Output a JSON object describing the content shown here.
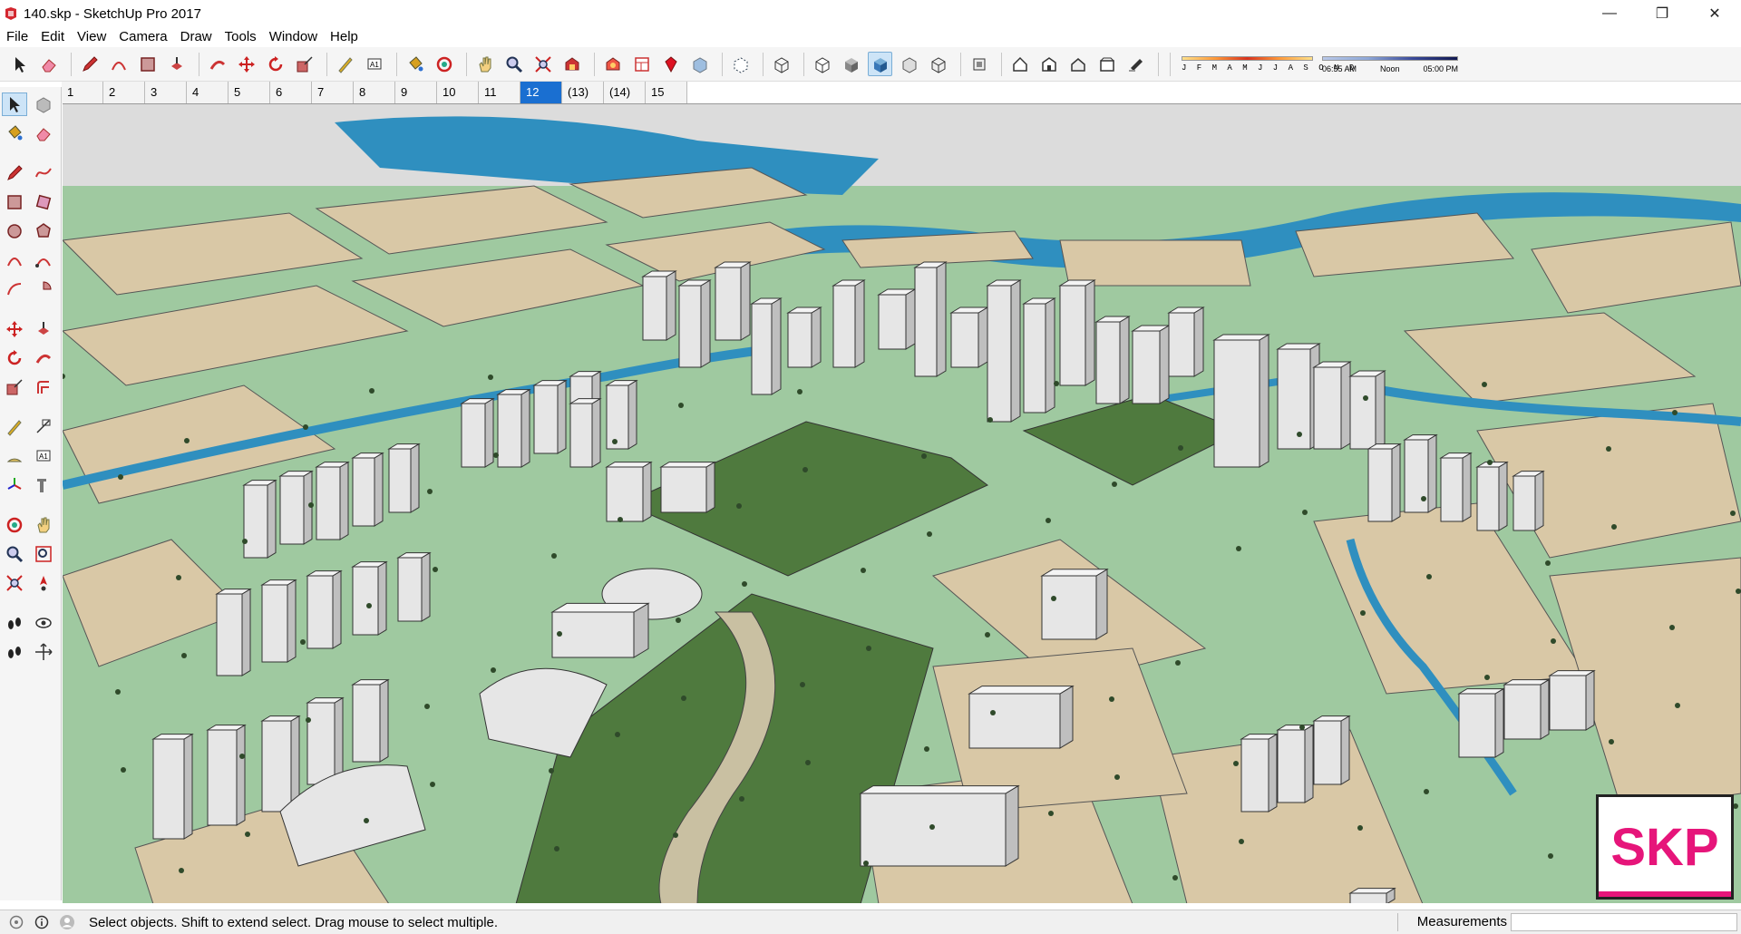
{
  "window": {
    "title": "140.skp - SketchUp Pro 2017",
    "minimize": "—",
    "restore": "❐",
    "close": "✕"
  },
  "menu": [
    "File",
    "Edit",
    "View",
    "Camera",
    "Draw",
    "Tools",
    "Window",
    "Help"
  ],
  "toolbar": {
    "icons": [
      "select-icon",
      "eraser-icon",
      "pencil-icon",
      "arc-icon",
      "rectangle-icon",
      "push-pull-icon",
      "follow-me-icon",
      "move-icon",
      "rotate-icon",
      "scale-icon",
      "tape-measure-icon",
      "text-icon",
      "paint-bucket-icon",
      "orbit-icon",
      "pan-icon",
      "zoom-icon",
      "zoom-extents-icon",
      "warehouse-icon",
      "extension-warehouse-icon",
      "layout-icon",
      "ruby-icon",
      "xray-icon",
      "back-edges-icon",
      "wireframe-icon",
      "hidden-line-icon",
      "shaded-icon",
      "shaded-textures-icon",
      "monochrome-icon",
      "iso-view-icon",
      "top-view-icon",
      "front-view-icon",
      "right-view-icon",
      "back-view-icon",
      "left-view-icon",
      "shadows-icon"
    ],
    "active_icon": "shaded-textures-icon",
    "shadow_months": "J F M A M J J A S O N D",
    "time_start": "06:55 AM",
    "time_mid": "Noon",
    "time_end": "05:00 PM"
  },
  "scenes": [
    {
      "label": "1",
      "active": false
    },
    {
      "label": "2",
      "active": false
    },
    {
      "label": "3",
      "active": false
    },
    {
      "label": "4",
      "active": false
    },
    {
      "label": "5",
      "active": false
    },
    {
      "label": "6",
      "active": false
    },
    {
      "label": "7",
      "active": false
    },
    {
      "label": "8",
      "active": false
    },
    {
      "label": "9",
      "active": false
    },
    {
      "label": "10",
      "active": false
    },
    {
      "label": "11",
      "active": false
    },
    {
      "label": "12",
      "active": true
    },
    {
      "label": "(13)",
      "active": false
    },
    {
      "label": "(14)",
      "active": false
    },
    {
      "label": "15",
      "active": false
    }
  ],
  "left_tools": [
    "select-icon",
    "component-icon",
    "paint-bucket-icon",
    "eraser-icon",
    "line-icon",
    "freehand-icon",
    "rectangle-icon",
    "rotated-rectangle-icon",
    "circle-icon",
    "polygon-icon",
    "arc-icon",
    "two-point-arc-icon",
    "three-point-arc-icon",
    "pie-icon",
    "move-icon",
    "push-pull-icon",
    "rotate-icon",
    "follow-me-icon",
    "scale-icon",
    "offset-icon",
    "tape-measure-icon",
    "dimension-icon",
    "protractor-icon",
    "text-icon",
    "axes-icon",
    "3d-text-icon",
    "orbit-icon",
    "pan-icon",
    "zoom-icon",
    "zoom-window-icon",
    "zoom-extents-icon",
    "position-camera-icon",
    "walk-icon",
    "look-around-icon",
    "footprints-icon",
    "section-plane-icon"
  ],
  "viewport": {
    "colors": {
      "road": "#9fc9a0",
      "parcel": "#d9c8a6",
      "water": "#2f8fbf",
      "building": "#e6e6e6",
      "park": "#4f7a3e",
      "plaza": "#cfcfcf"
    },
    "logo": "SKP",
    "logo_color": "#e6157a"
  },
  "status": {
    "message": "Select objects. Shift to extend select. Drag mouse to select multiple.",
    "measurements_label": "Measurements",
    "measurements_value": ""
  }
}
